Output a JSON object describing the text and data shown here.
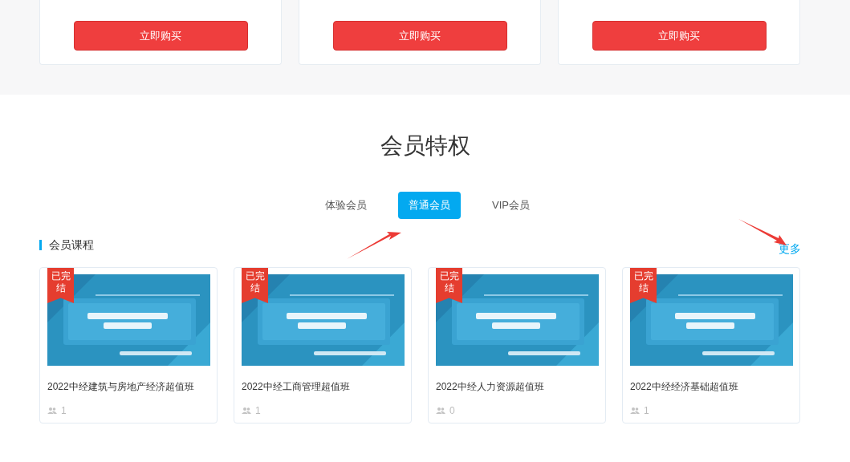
{
  "plans": [
    {
      "button": "立即购买"
    },
    {
      "button": "立即购买"
    },
    {
      "button": "立即购买"
    }
  ],
  "section_title": "会员特权",
  "tabs": [
    {
      "label": "体验会员",
      "selected": false
    },
    {
      "label": "普通会员",
      "selected": true
    },
    {
      "label": "VIP会员",
      "selected": false
    }
  ],
  "courses_header": {
    "title": "会员课程",
    "more": "更多"
  },
  "courses": [
    {
      "badge": "已完结",
      "title": "2022中经建筑与房地产经济超值班",
      "count": "1"
    },
    {
      "badge": "已完结",
      "title": "2022中经工商管理超值班",
      "count": "1"
    },
    {
      "badge": "已完结",
      "title": "2022中经人力资源超值班",
      "count": "0"
    },
    {
      "badge": "已完结",
      "title": "2022中经经济基础超值班",
      "count": "1"
    }
  ]
}
